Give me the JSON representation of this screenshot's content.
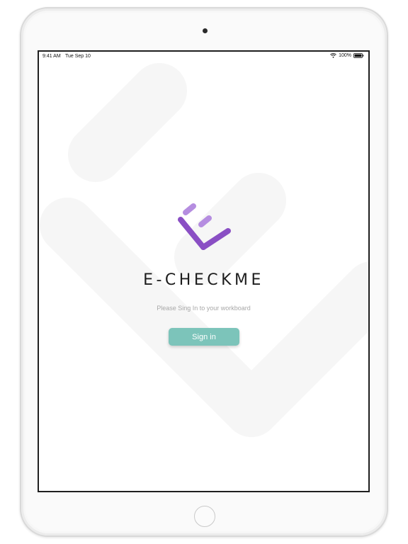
{
  "status_bar": {
    "time": "9:41 AM",
    "date": "Tue Sep 10",
    "battery": "100%",
    "wifi_icon": "wifi-icon",
    "battery_icon": "battery-icon"
  },
  "app": {
    "title": "E-CHECKME",
    "subtitle": "Please Sing In  to your workboard",
    "signin_label": "Sign in"
  },
  "colors": {
    "brand_purple": "#8a4fc4",
    "brand_purple_light": "#b58de0",
    "button_teal": "#7cc4ba",
    "background_watermark": "#f5f5f5"
  }
}
